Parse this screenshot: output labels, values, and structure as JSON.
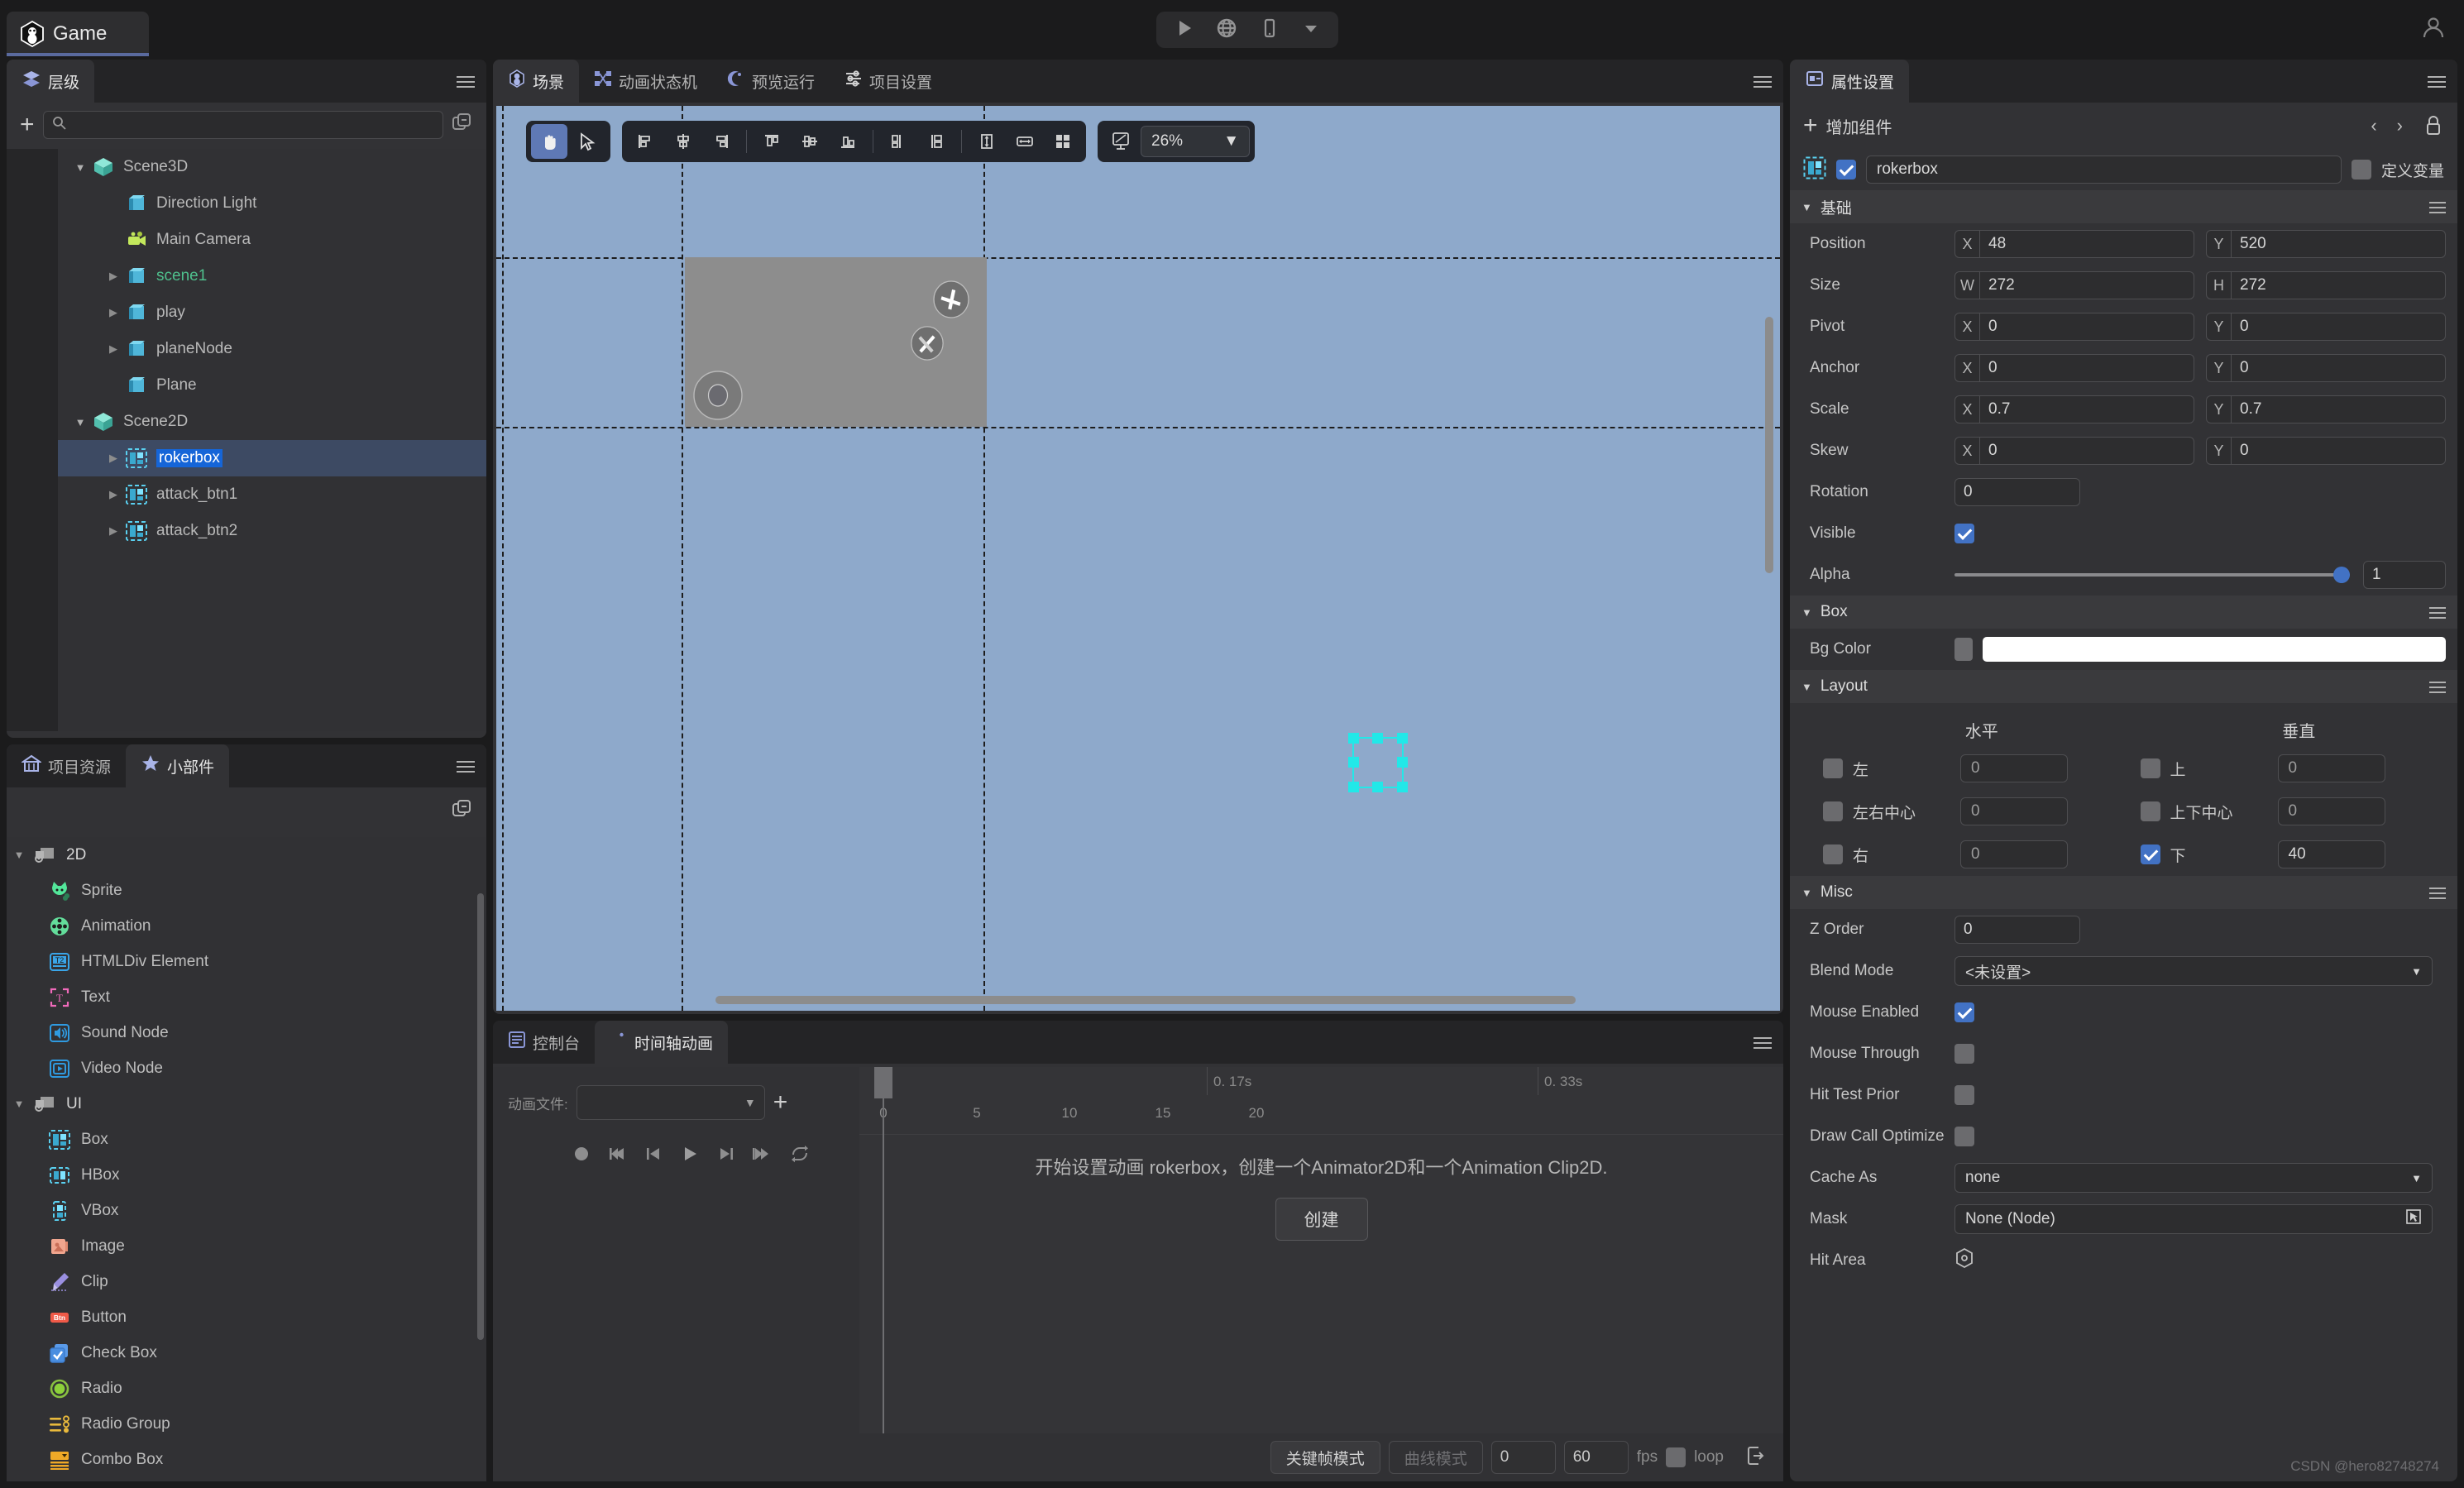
{
  "topbar": {
    "app_tab": "Game",
    "controls": [
      "play-icon",
      "globe-icon",
      "phone-icon",
      "chevron-down-icon"
    ],
    "user_icon": "user-icon"
  },
  "hierarchy": {
    "tab": "层级",
    "search_placeholder": "",
    "search_value": "",
    "add_label": "+",
    "nodes": [
      {
        "label": "Scene3D",
        "depth": 0,
        "arrow": "open",
        "icon": "cube-3d-icon",
        "selected": false,
        "green": false
      },
      {
        "label": "Direction Light",
        "depth": 1,
        "arrow": "none",
        "icon": "box-icon",
        "selected": false,
        "green": false
      },
      {
        "label": "Main Camera",
        "depth": 1,
        "arrow": "none",
        "icon": "camera-icon",
        "selected": false,
        "green": false
      },
      {
        "label": "scene1",
        "depth": 1,
        "arrow": "closed",
        "icon": "box-icon",
        "selected": false,
        "green": true
      },
      {
        "label": "play",
        "depth": 1,
        "arrow": "closed",
        "icon": "box-icon",
        "selected": false,
        "green": false
      },
      {
        "label": "planeNode",
        "depth": 1,
        "arrow": "closed",
        "icon": "box-icon",
        "selected": false,
        "green": false
      },
      {
        "label": "Plane",
        "depth": 1,
        "arrow": "none",
        "icon": "box-icon",
        "selected": false,
        "green": false
      },
      {
        "label": "Scene2D",
        "depth": 0,
        "arrow": "open",
        "icon": "cube-3d-icon",
        "selected": false,
        "green": false
      },
      {
        "label": "rokerbox",
        "depth": 1,
        "arrow": "closed",
        "icon": "ui-box-icon",
        "selected": true,
        "green": false
      },
      {
        "label": "attack_btn1",
        "depth": 1,
        "arrow": "closed",
        "icon": "ui-box-icon",
        "selected": false,
        "green": false
      },
      {
        "label": "attack_btn2",
        "depth": 1,
        "arrow": "closed",
        "icon": "ui-box-icon",
        "selected": false,
        "green": false
      }
    ]
  },
  "assets": {
    "tabs": [
      {
        "label": "项目资源",
        "icon": "home-icon",
        "active": false
      },
      {
        "label": "小部件",
        "icon": "star-icon",
        "active": true
      }
    ],
    "copy_icon": "copy-minus-icon",
    "groups": [
      {
        "label": "2D",
        "icon": "folder-2d-icon",
        "open": true,
        "items": [
          {
            "label": "Sprite",
            "icon": "sprite-icon"
          },
          {
            "label": "Animation",
            "icon": "animation-icon"
          },
          {
            "label": "HTMLDiv Element",
            "icon": "htmldiv-icon"
          },
          {
            "label": "Text",
            "icon": "text-icon"
          },
          {
            "label": "Sound Node",
            "icon": "sound-icon"
          },
          {
            "label": "Video Node",
            "icon": "video-icon"
          }
        ]
      },
      {
        "label": "UI",
        "icon": "folder-ui-icon",
        "open": true,
        "items": [
          {
            "label": "Box",
            "icon": "box-ui-icon"
          },
          {
            "label": "HBox",
            "icon": "hbox-icon"
          },
          {
            "label": "VBox",
            "icon": "vbox-icon"
          },
          {
            "label": "Image",
            "icon": "image-icon"
          },
          {
            "label": "Clip",
            "icon": "clip-icon"
          },
          {
            "label": "Button",
            "icon": "button-icon"
          },
          {
            "label": "Check Box",
            "icon": "checkbox-icon"
          },
          {
            "label": "Radio",
            "icon": "radio-icon"
          },
          {
            "label": "Radio Group",
            "icon": "radio-group-icon"
          },
          {
            "label": "Combo Box",
            "icon": "combobox-icon"
          }
        ]
      }
    ]
  },
  "scene": {
    "tabs": [
      {
        "label": "场景",
        "icon": "scene-icon",
        "active": true
      },
      {
        "label": "动画状态机",
        "icon": "state-machine-icon",
        "active": false
      },
      {
        "label": "预览运行",
        "icon": "preview-run-icon",
        "active": false
      },
      {
        "label": "项目设置",
        "icon": "project-settings-icon",
        "active": false
      }
    ],
    "toolbar": {
      "hand_tool": "hand-icon",
      "select_tool": "cursor-icon",
      "align_tools": [
        "align-left-icon",
        "align-center-h-icon",
        "align-right-icon",
        "align-top-icon",
        "align-middle-v-icon",
        "align-bottom-icon",
        "distribute-h-icon",
        "distribute-v-icon",
        "stretch-v-icon",
        "stretch-h-icon",
        "grid-icon"
      ],
      "ratio_icon": "ratio-icon",
      "zoom_value": "26%"
    }
  },
  "bottom": {
    "tabs": [
      {
        "label": "控制台",
        "icon": "console-icon",
        "active": false
      },
      {
        "label": "时间轴动画",
        "icon": "timeline-icon",
        "active": true
      }
    ],
    "anim_file_label": "动画文件:",
    "anim_file_value": "",
    "transport": [
      "record-icon",
      "skip-start-icon",
      "prev-frame-icon",
      "play-icon",
      "next-frame-icon",
      "skip-end-icon",
      "loop-icon"
    ],
    "ruler": {
      "sec_labels": [
        "0. 17s",
        "0. 33s"
      ],
      "ticks": [
        "0",
        "5",
        "10",
        "15",
        "20"
      ]
    },
    "empty_message": "开始设置动画 rokerbox，创建一个Animator2D和一个Animation Clip2D.",
    "create_button": "创建",
    "footer": {
      "keyframe_mode": "关键帧模式",
      "curve_mode": "曲线模式",
      "start_frame": "0",
      "fps_value": "60",
      "fps_label": "fps",
      "loop_label": "loop",
      "loop_checked": false,
      "export_icon": "export-icon"
    }
  },
  "props": {
    "tab": "属性设置",
    "add_component": "增加组件",
    "nav_prev": "‹",
    "nav_next": "›",
    "lock_icon": "lock-icon",
    "node": {
      "icon": "ui-box-icon",
      "enabled": true,
      "name": "rokerbox",
      "define_var_label": "定义变量",
      "define_var_checked": false
    },
    "sections": {
      "basic": {
        "title": "基础",
        "rows": [
          {
            "label": "Position",
            "type": "xy",
            "x_tag": "X",
            "x": "48",
            "y_tag": "Y",
            "y": "520"
          },
          {
            "label": "Size",
            "type": "xy",
            "x_tag": "W",
            "x": "272",
            "y_tag": "H",
            "y": "272"
          },
          {
            "label": "Pivot",
            "type": "xy",
            "x_tag": "X",
            "x": "0",
            "y_tag": "Y",
            "y": "0"
          },
          {
            "label": "Anchor",
            "type": "xy",
            "x_tag": "X",
            "x": "0",
            "y_tag": "Y",
            "y": "0"
          },
          {
            "label": "Scale",
            "type": "xy",
            "x_tag": "X",
            "x": "0.7",
            "y_tag": "Y",
            "y": "0.7"
          },
          {
            "label": "Skew",
            "type": "xy",
            "x_tag": "X",
            "x": "0",
            "y_tag": "Y",
            "y": "0"
          },
          {
            "label": "Rotation",
            "type": "single",
            "value": "0"
          },
          {
            "label": "Visible",
            "type": "check",
            "checked": true
          },
          {
            "label": "Alpha",
            "type": "slider",
            "value": "1",
            "percent": 100
          }
        ]
      },
      "box": {
        "title": "Box",
        "bg_color_label": "Bg Color",
        "bg_color": "#ffffff"
      },
      "layout": {
        "title": "Layout",
        "col_h": "水平",
        "col_v": "垂直",
        "rows": [
          {
            "h_label": "左",
            "h_checked": false,
            "h_value": "0",
            "v_label": "上",
            "v_checked": false,
            "v_value": "0"
          },
          {
            "h_label": "左右中心",
            "h_checked": false,
            "h_value": "0",
            "v_label": "上下中心",
            "v_checked": false,
            "v_value": "0"
          },
          {
            "h_label": "右",
            "h_checked": false,
            "h_value": "0",
            "v_label": "下",
            "v_checked": true,
            "v_value": "40"
          }
        ]
      },
      "misc": {
        "title": "Misc",
        "rows": [
          {
            "label": "Z Order",
            "type": "single",
            "value": "0"
          },
          {
            "label": "Blend Mode",
            "type": "select",
            "value": "<未设置>"
          },
          {
            "label": "Mouse Enabled",
            "type": "check",
            "checked": true
          },
          {
            "label": "Mouse Through",
            "type": "check",
            "checked": false
          },
          {
            "label": "Hit Test Prior",
            "type": "check",
            "checked": false
          },
          {
            "label": "Draw Call Optimize",
            "type": "check",
            "checked": false
          },
          {
            "label": "Cache As",
            "type": "select",
            "value": "none"
          },
          {
            "label": "Mask",
            "type": "pick",
            "value": "None (Node)"
          },
          {
            "label": "Hit Area",
            "type": "hex",
            "value": ""
          }
        ]
      }
    }
  },
  "watermark": "CSDN @hero82748274",
  "colors": {
    "accent_blue": "#4272c4",
    "selection_blue": "#1565d8",
    "viewport_bg": "#8ea9cb",
    "stage_bg": "#8d8d8d",
    "gizmo_cyan": "#22e8e8",
    "panel_bg": "#323235"
  }
}
